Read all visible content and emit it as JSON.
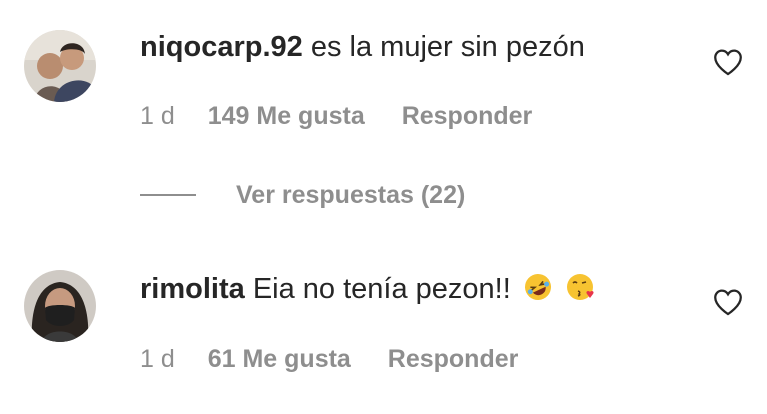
{
  "comments": [
    {
      "username": "niqocarp.92",
      "text": "es la mujer sin pezón",
      "time": "1 d",
      "likes": "149 Me gusta",
      "reply": "Responder",
      "avatar_icon": "user-avatar-two-men"
    },
    {
      "username": "rimolita",
      "text": "Eia no tenía pezon!!",
      "time": "1 d",
      "likes": "61 Me gusta",
      "reply": "Responder",
      "avatar_icon": "user-avatar-masked-woman",
      "emojis": [
        "rolling-on-floor-laughing-emoji",
        "face-blowing-kiss-emoji"
      ]
    }
  ],
  "view_replies": "Ver respuestas (22)",
  "colors": {
    "text": "#262626",
    "muted": "#8e8e8e",
    "background": "#ffffff"
  }
}
